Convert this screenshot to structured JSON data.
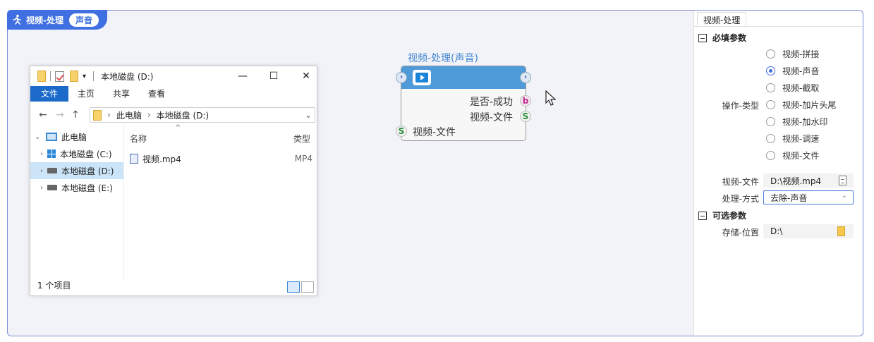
{
  "window": {
    "title": "视频-处理",
    "badge": "声音"
  },
  "explorer": {
    "title": "本地磁盘 (D:)",
    "menu": [
      "文件",
      "主页",
      "共享",
      "查看"
    ],
    "breadcrumb": [
      "此电脑",
      "本地磁盘 (D:)"
    ],
    "tree": [
      {
        "label": "此电脑",
        "selected": false
      },
      {
        "label": "本地磁盘 (C:)",
        "selected": false
      },
      {
        "label": "本地磁盘 (D:)",
        "selected": true
      },
      {
        "label": "本地磁盘 (E:)",
        "selected": false
      }
    ],
    "columns": {
      "name": "名称",
      "type": "类型"
    },
    "files": [
      {
        "name": "视频.mp4",
        "type": "MP4"
      }
    ],
    "status": "1 个项目"
  },
  "node": {
    "title": "视频-处理(声音)",
    "outputs": [
      {
        "label": "是否-成功",
        "port": "b"
      },
      {
        "label": "视频-文件",
        "port": "S"
      }
    ],
    "inputs": [
      {
        "label": "视频-文件",
        "port": "S"
      }
    ]
  },
  "panel": {
    "tab": "视频-处理",
    "required_section": "必填参数",
    "op_type_label": "操作-类型",
    "op_types": [
      {
        "label": "视频-拼接",
        "selected": false
      },
      {
        "label": "视频-声音",
        "selected": true
      },
      {
        "label": "视频-截取",
        "selected": false
      },
      {
        "label": "视频-加片头尾",
        "selected": false
      },
      {
        "label": "视频-加水印",
        "selected": false
      },
      {
        "label": "视频-调速",
        "selected": false
      },
      {
        "label": "视频-文件",
        "selected": false
      }
    ],
    "video_file_label": "视频-文件",
    "video_file_value": "D:\\视频.mp4",
    "method_label": "处理-方式",
    "method_value": "去除-声音",
    "optional_section": "可选参数",
    "storage_label": "存储-位置",
    "storage_value": "D:\\"
  },
  "colors": {
    "accent": "#3f6fe0",
    "node_header": "#4f9ad8",
    "menu_active": "#1b6ac9"
  }
}
